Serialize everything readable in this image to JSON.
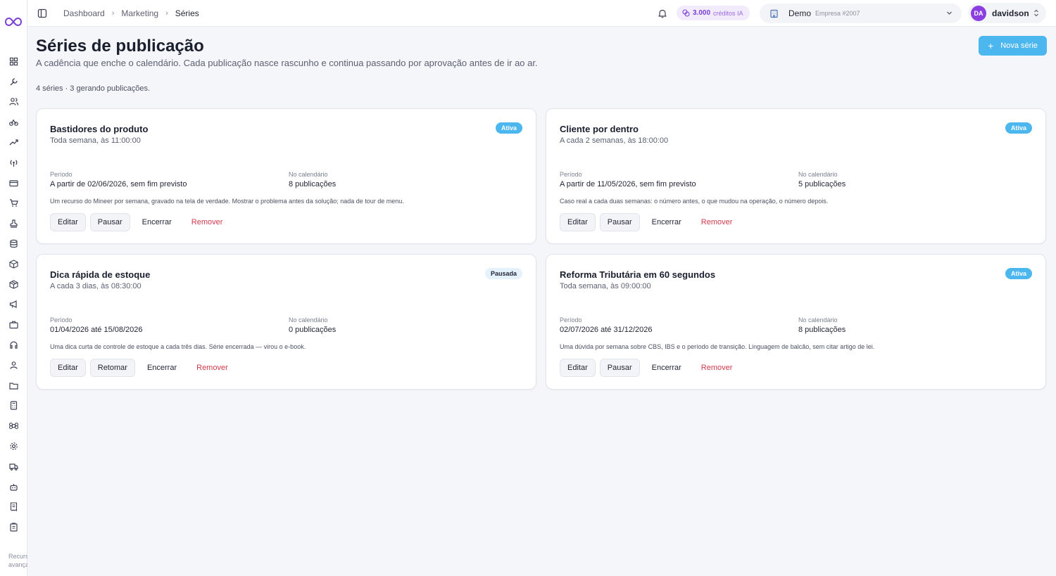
{
  "sidebar": {
    "icons": [
      "grid-icon",
      "wrench-icon",
      "users-icon",
      "bike-icon",
      "trend-icon",
      "antenna-icon",
      "card-icon",
      "cart-icon",
      "stamp-icon",
      "database-icon",
      "box-icon",
      "package-icon",
      "megaphone-icon",
      "briefcase-icon",
      "headset-icon",
      "user-group-icon",
      "folder-icon",
      "calculator-icon",
      "command-icon",
      "gear-icon",
      "truck-icon",
      "robot-icon",
      "receipt-icon",
      "clipboard-icon"
    ],
    "footer_line1": "Recursos",
    "footer_line2": "avançados"
  },
  "topbar": {
    "breadcrumb": [
      "Dashboard",
      "Marketing",
      "Séries"
    ],
    "credits_amount": "3.000",
    "credits_unit": "créditos IA",
    "company_name": "Demo",
    "company_sub": "Empresa #2007",
    "user_initials": "DA",
    "user_name": "davidson"
  },
  "header": {
    "title": "Séries de publicação",
    "subtitle": "A cadência que enche o calendário. Cada publicação nasce rascunho e continua passando por aprovação antes de ir ao ar.",
    "summary": "4 séries · 3 gerando publicações.",
    "new_button": "Nova série"
  },
  "labels": {
    "period": "Período",
    "calendar": "No calendário"
  },
  "cards": [
    {
      "title": "Bastidores do produto",
      "schedule": "Toda semana, às 11:00:00",
      "status": "Ativa",
      "period": "A partir de 02/06/2026, sem fim previsto",
      "calendar": "8 publicações",
      "description": "Um recurso do Mineer por semana, gravado na tela de verdade. Mostrar o problema antes da solução; nada de tour de menu.",
      "actions": [
        "Editar",
        "Pausar",
        "Encerrar",
        "Remover"
      ]
    },
    {
      "title": "Cliente por dentro",
      "schedule": "A cada 2 semanas, às 18:00:00",
      "status": "Ativa",
      "period": "A partir de 11/05/2026, sem fim previsto",
      "calendar": "5 publicações",
      "description": "Caso real a cada duas semanas: o número antes, o que mudou na operação, o número depois.",
      "actions": [
        "Editar",
        "Pausar",
        "Encerrar",
        "Remover"
      ]
    },
    {
      "title": "Dica rápida de estoque",
      "schedule": "A cada 3 dias, às 08:30:00",
      "status": "Pausada",
      "period": "01/04/2026 até 15/08/2026",
      "calendar": "0 publicações",
      "description": "Uma dica curta de controle de estoque a cada três dias. Série encerrada — virou o e-book.",
      "actions": [
        "Editar",
        "Retomar",
        "Encerrar",
        "Remover"
      ]
    },
    {
      "title": "Reforma Tributária em 60 segundos",
      "schedule": "Toda semana, às 09:00:00",
      "status": "Ativa",
      "period": "02/07/2026 até 31/12/2026",
      "calendar": "8 publicações",
      "description": "Uma dúvida por semana sobre CBS, IBS e o período de transição. Linguagem de balcão, sem citar artigo de lei.",
      "actions": [
        "Editar",
        "Pausar",
        "Encerrar",
        "Remover"
      ]
    }
  ]
}
